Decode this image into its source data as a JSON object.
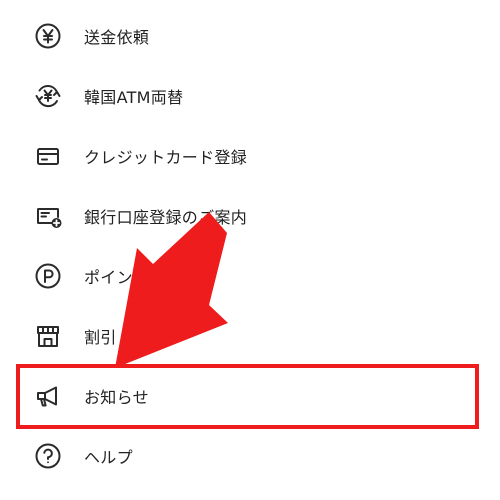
{
  "menu": {
    "items": [
      {
        "key": "remittance",
        "label": "送金依頼",
        "icon": "yen-circle-icon"
      },
      {
        "key": "korea-atm",
        "label": "韓国ATM両替",
        "icon": "yen-exchange-icon"
      },
      {
        "key": "credit-card",
        "label": "クレジットカード登録",
        "icon": "credit-card-icon"
      },
      {
        "key": "bank-account",
        "label": "銀行口座登録のご案内",
        "icon": "bank-card-plus-icon"
      },
      {
        "key": "points",
        "label": "ポイント",
        "icon": "p-circle-icon"
      },
      {
        "key": "discount",
        "label": "割引",
        "icon": "store-icon"
      },
      {
        "key": "news",
        "label": "お知らせ",
        "icon": "megaphone-icon"
      },
      {
        "key": "help",
        "label": "ヘルプ",
        "icon": "question-circle-icon"
      }
    ]
  },
  "annotation": {
    "color": "#ee1c1c",
    "highlighted_item": "news",
    "arrow_icon": "red-arrow-icon"
  },
  "theme": {
    "icon_color": "#2b2b2b",
    "text_color": "#222222",
    "background": "#ffffff"
  }
}
